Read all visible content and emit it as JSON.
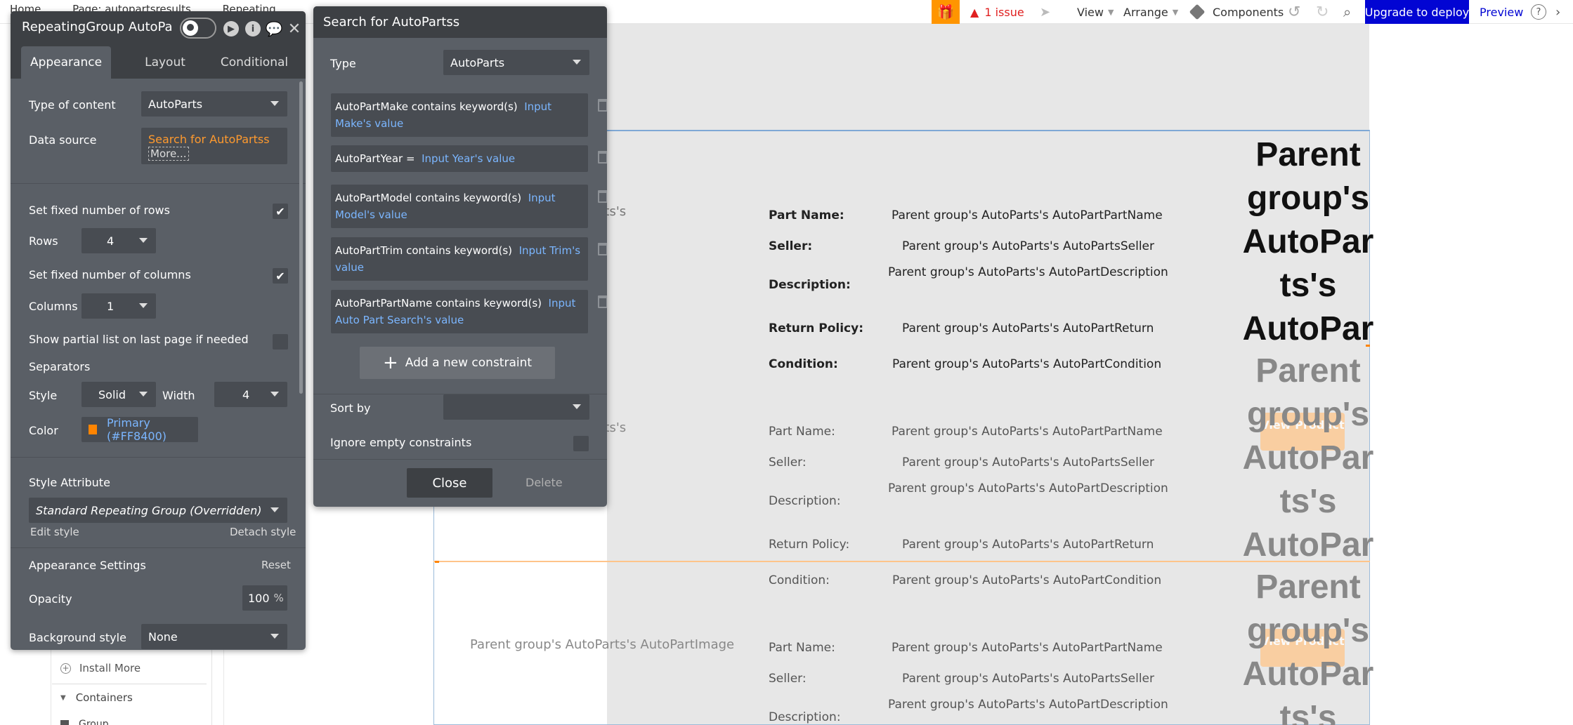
{
  "topbar": {
    "crumbs": [
      "Home",
      "Page: autopartsresults",
      "Repeating"
    ],
    "issue_text": "1 issue",
    "view_label": "View",
    "arrange_label": "Arrange",
    "components_label": "Components",
    "upgrade_label": "Upgrade to deploy",
    "preview_label": "Preview",
    "help_glyph": "?"
  },
  "left_sidebar": {
    "install_more": "Install More",
    "containers": "Containers",
    "group": "Group"
  },
  "property_panel": {
    "title": "RepeatingGroup AutoPa",
    "tabs": [
      "Appearance",
      "Layout",
      "Conditional"
    ],
    "type_of_content_label": "Type of content",
    "type_of_content_value": "AutoParts",
    "data_source_label": "Data source",
    "data_source_value": "Search for AutoPartss",
    "data_source_more": "More...",
    "fixed_rows_label": "Set fixed number of rows",
    "fixed_rows_checked": "✔",
    "rows_label": "Rows",
    "rows_value": "4",
    "fixed_columns_label": "Set fixed number of columns",
    "fixed_columns_checked": "✔",
    "columns_label": "Columns",
    "columns_value": "1",
    "partial_list_label": "Show partial list on last page if needed",
    "separators_label": "Separators",
    "style_label": "Style",
    "style_value": "Solid",
    "width_label": "Width",
    "width_value": "4",
    "color_label": "Color",
    "color_value": "Primary (#FF8400)",
    "swatch_color": "#FF8400",
    "style_attribute_label": "Style Attribute",
    "style_attribute_value": "Standard Repeating Group (Overridden)",
    "edit_style": "Edit style",
    "detach_style": "Detach style",
    "appearance_settings_label": "Appearance Settings",
    "reset_label": "Reset",
    "opacity_label": "Opacity",
    "opacity_value": "100",
    "opacity_unit": "%",
    "background_style_label": "Background style",
    "background_style_value": "None"
  },
  "search_popup": {
    "title": "Search for AutoPartss",
    "type_label": "Type",
    "type_value": "AutoParts",
    "constraints": [
      {
        "field": "AutoPartMake contains keyword(s)",
        "value": "Input Make's value"
      },
      {
        "field": "AutoPartYear =",
        "value": "Input Year's value"
      },
      {
        "field": "AutoPartModel contains keyword(s)",
        "value": "Input Model's value"
      },
      {
        "field": "AutoPartTrim contains keyword(s)",
        "value": "Input Trim's value"
      },
      {
        "field": "AutoPartPartName contains keyword(s)",
        "value": "Input Auto Part Search's value"
      }
    ],
    "add_constraint_label": "Add a new constraint",
    "sort_by_label": "Sort by",
    "ignore_empty_label": "Ignore empty constraints",
    "close_label": "Close",
    "delete_label": "Delete"
  },
  "canvas": {
    "labels": {
      "part_name": "Part Name:",
      "seller": "Seller:",
      "description": "Description:",
      "return_policy": "Return Policy:",
      "condition": "Condition:"
    },
    "values": {
      "part_name": "Parent group's AutoParts's AutoPartPartName",
      "seller": "Parent group's AutoParts's AutoPartsSeller",
      "description": "Parent group's AutoParts's AutoPartDescription",
      "return_policy": "Parent group's AutoParts's AutoPartReturn",
      "condition": "Parent group's AutoParts's AutoPartCondition"
    },
    "image_text_fragment": "rts's",
    "image_text_full": "Parent group's AutoParts's AutoPartImage",
    "big_text_lines": [
      "Parent",
      "group's",
      "AutoPar",
      "ts's",
      "AutoPar"
    ],
    "view_product_label": "View Product"
  }
}
